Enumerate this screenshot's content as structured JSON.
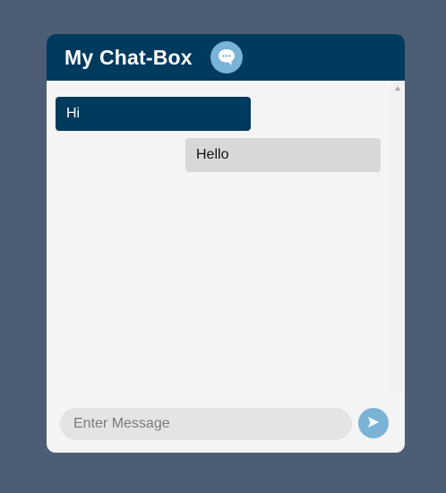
{
  "header": {
    "title": "My Chat-Box",
    "icon": "chat-bubble-icon"
  },
  "messages": [
    {
      "text": "Hi",
      "side": "left"
    },
    {
      "text": "Hello",
      "side": "right"
    }
  ],
  "composer": {
    "placeholder": "Enter Message",
    "send_icon": "send-icon"
  },
  "colors": {
    "page_background": "#4d5d76",
    "header": "#003a5c",
    "accent": "#7ab3d6",
    "panel": "#f4f4f4",
    "received_bubble": "#d8d8d8",
    "input_background": "#e3e4e6"
  }
}
